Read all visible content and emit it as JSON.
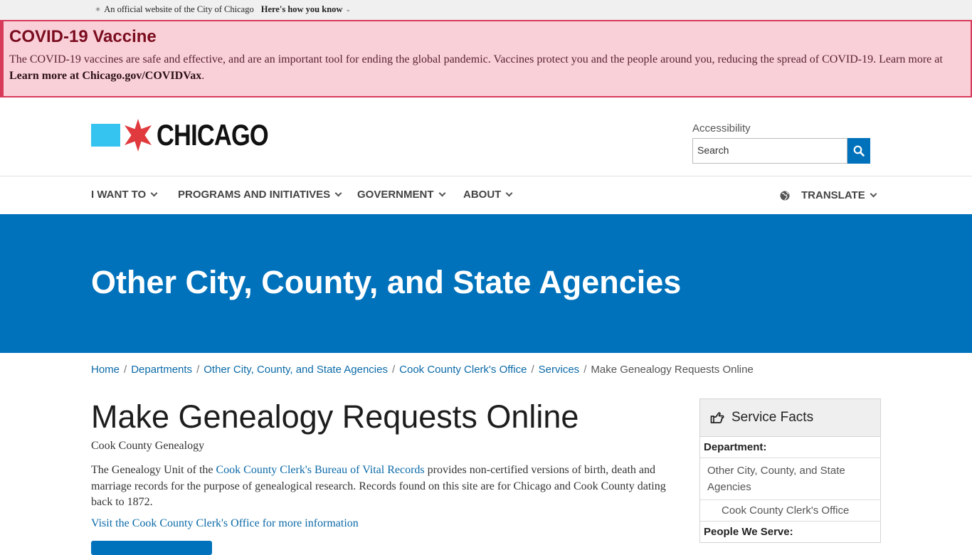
{
  "gov_banner": {
    "text": "An official website of the City of Chicago",
    "link": "Here's how you know"
  },
  "alert": {
    "title": "COVID-19 Vaccine",
    "text": "The COVID-19 vaccines are safe and effective, and are an important tool for ending the global pandemic. Vaccines protect you and the people around you, reducing the spread of COVID-19. Learn more at",
    "link": "Learn more at Chicago.gov/COVIDVax",
    "suffix": "."
  },
  "header": {
    "logo_text": "CHICAGO",
    "accessibility": "Accessibility",
    "search_placeholder": "Search"
  },
  "nav": {
    "items": [
      "I WANT TO",
      "PROGRAMS AND INITIATIVES",
      "GOVERNMENT",
      "ABOUT"
    ],
    "translate": "TRANSLATE"
  },
  "hero": {
    "title": "Other City, County, and State Agencies"
  },
  "breadcrumb": {
    "items": [
      "Home",
      "Departments",
      "Other City, County, and State Agencies",
      "Cook County Clerk's Office",
      "Services"
    ],
    "current": "Make Genealogy Requests Online",
    "separator": "/"
  },
  "main": {
    "title": "Make Genealogy Requests Online",
    "subtitle": "Cook County Genealogy",
    "body_pre": "The Genealogy Unit of the",
    "body_link": "Cook County Clerk's Bureau of Vital Records",
    "body_post": "provides non-certified versions of birth, death and marriage records for the purpose of genealogical research. Records found on this site are for Chicago and Cook County dating back to 1872.",
    "more_link": "Visit the Cook County Clerk's Office for more information"
  },
  "service_facts": {
    "title": "Service Facts",
    "department_label": "Department:",
    "department_value": "Other City, County, and State Agencies",
    "department_sub": "Cook County Clerk's Office",
    "people_label": "People We Serve:"
  },
  "colors": {
    "primary": "#0072bb",
    "alert_bg": "#f9cfd8",
    "alert_border": "#d83a5a",
    "logo_blue": "#35c4ef",
    "logo_star": "#e03a3e"
  }
}
